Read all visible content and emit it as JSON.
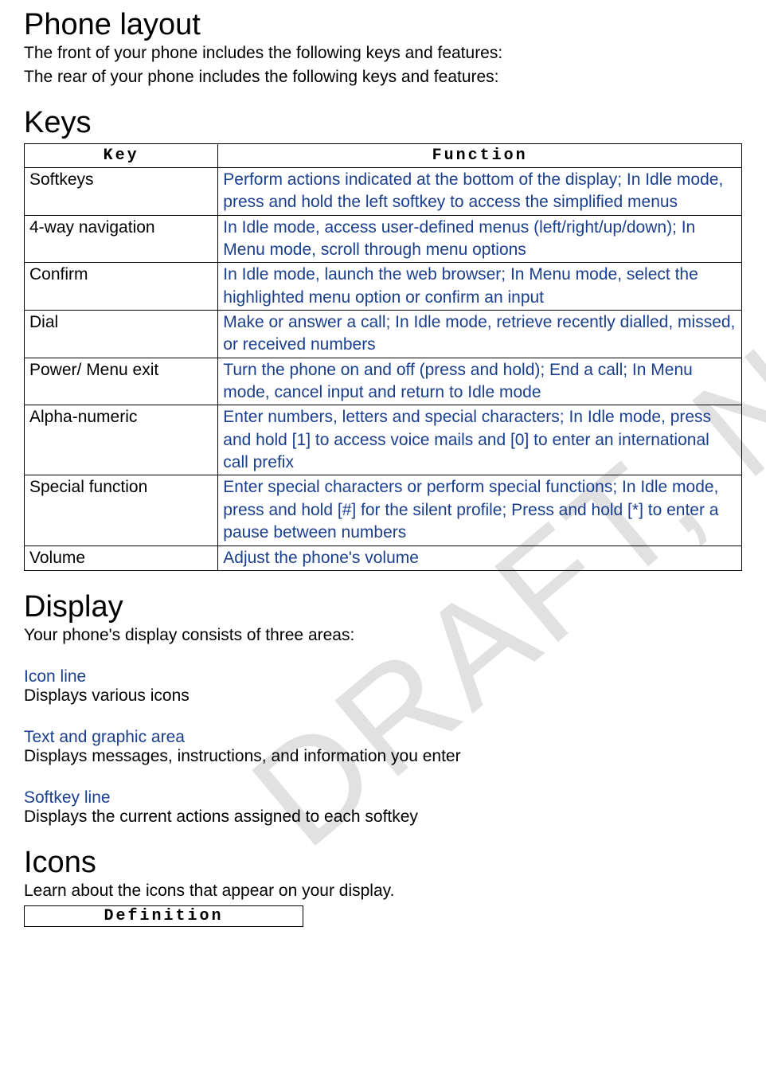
{
  "watermark": "DRAFT, Not Final",
  "sections": {
    "phone_layout": {
      "heading": "Phone layout",
      "front_line": "The front of your phone includes the following keys and features:",
      "rear_line": "The rear of your phone includes the following keys and features:"
    },
    "keys": {
      "heading": "Keys",
      "col_key": "Key",
      "col_function": "Function",
      "rows": [
        {
          "key": "Softkeys",
          "fn": "Perform actions indicated at the bottom of the display; In Idle mode, press and hold the left softkey to access the simplified menus"
        },
        {
          "key": "4-way navigation",
          "fn": "In Idle mode, access user-defined menus (left/right/up/down); In Menu mode, scroll through menu options"
        },
        {
          "key": "Confirm",
          "fn": "In Idle mode, launch the web browser; In Menu mode, select the highlighted menu option or confirm an input"
        },
        {
          "key": "Dial",
          "fn": "Make or answer a call; In Idle mode, retrieve recently dialled, missed, or received numbers"
        },
        {
          "key": "Power/ Menu exit",
          "fn": "Turn the phone on and off (press and hold); End a call; In Menu mode, cancel input and return to Idle mode"
        },
        {
          "key": "Alpha-numeric",
          "fn": "Enter numbers, letters and special characters; In Idle mode, press and hold [1] to access voice mails and [0] to enter an international call prefix"
        },
        {
          "key": "Special function",
          "fn": "Enter special characters or perform special functions; In Idle mode, press and hold [#] for the silent profile; Press and hold [*] to enter a pause between numbers"
        },
        {
          "key": "Volume",
          "fn": "Adjust the phone's volume"
        }
      ]
    },
    "display": {
      "heading": "Display",
      "intro": "Your phone's display consists of three areas:",
      "areas": [
        {
          "title": "Icon line",
          "desc": "Displays various icons"
        },
        {
          "title": "Text and graphic area",
          "desc": "Displays messages, instructions, and information you enter"
        },
        {
          "title": "Softkey line",
          "desc": "Displays the current actions assigned to each softkey"
        }
      ]
    },
    "icons": {
      "heading": "Icons",
      "intro": "Learn about the icons that appear on your display.",
      "col_definition": "Definition"
    }
  }
}
